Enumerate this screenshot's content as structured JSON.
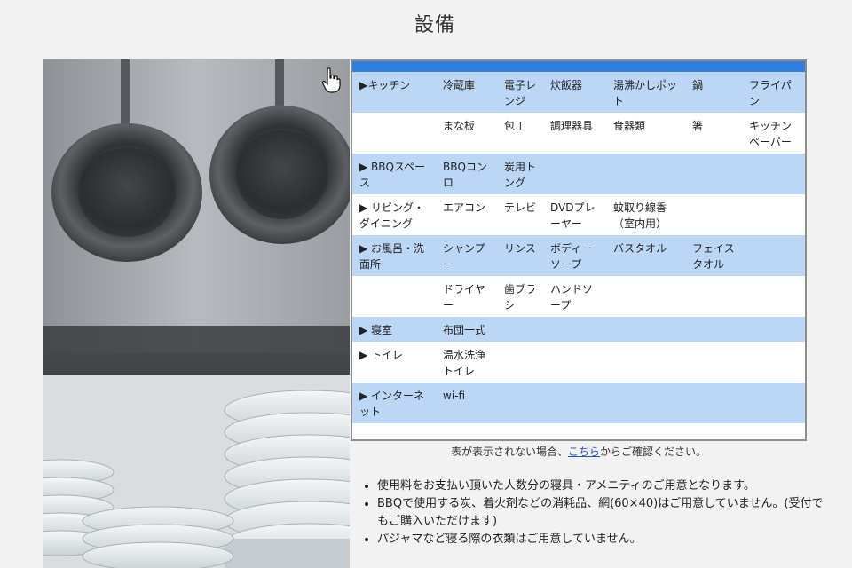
{
  "page": {
    "title": "設備"
  },
  "table": {
    "rows": [
      {
        "style": "alt",
        "cells": [
          "▶キッチン",
          "冷蔵庫",
          "電子レンジ",
          "炊飯器",
          "湯沸かしポット",
          "鍋",
          "フライパン"
        ]
      },
      {
        "style": "plain",
        "cells": [
          "",
          "まな板",
          "包丁",
          "調理器具",
          "食器類",
          "箸",
          "キッチンペーパー"
        ]
      },
      {
        "style": "alt",
        "cells": [
          "▶ BBQスペース",
          "BBQコンロ",
          "炭用トング",
          "",
          "",
          "",
          ""
        ]
      },
      {
        "style": "plain",
        "cells": [
          "▶ リビング・ダイニング",
          "エアコン",
          "テレビ",
          "DVDプレーヤー",
          "蚊取り線香（室内用）",
          "",
          ""
        ]
      },
      {
        "style": "alt",
        "cells": [
          "▶ お風呂・洗面所",
          "シャンプー",
          "リンス",
          "ボディーソープ",
          "バスタオル",
          "フェイスタオル",
          ""
        ]
      },
      {
        "style": "plain",
        "cells": [
          "",
          "ドライヤー",
          "歯ブラシ",
          "ハンドソープ",
          "",
          "",
          ""
        ]
      },
      {
        "style": "alt",
        "cells": [
          "▶ 寝室",
          "布団一式",
          "",
          "",
          "",
          "",
          ""
        ]
      },
      {
        "style": "plain",
        "cells": [
          "▶ トイレ",
          "温水洗浄トイレ",
          "",
          "",
          "",
          "",
          ""
        ]
      },
      {
        "style": "alt",
        "cells": [
          "▶ インターネット",
          "wi-fi",
          "",
          "",
          "",
          "",
          ""
        ]
      }
    ]
  },
  "caption": {
    "before": "表が表示されない場合、",
    "link": "こちら",
    "after": "からご確認ください。"
  },
  "notes": [
    "使用料をお支払い頂いた人数分の寝具・アメニティのご用意となります。",
    "BBQで使用する炭、着火剤などの消耗品、網(60×40)はご用意していません。(受付でもご購入いただけます)",
    "パジャマなど寝る際の衣類はご用意していません。"
  ],
  "icons": {
    "cursor": "hand-pointer-icon"
  },
  "colors": {
    "table_header_bar": "#2f7fe0",
    "row_alt": "#bcd6f5",
    "link": "#2255cc"
  }
}
